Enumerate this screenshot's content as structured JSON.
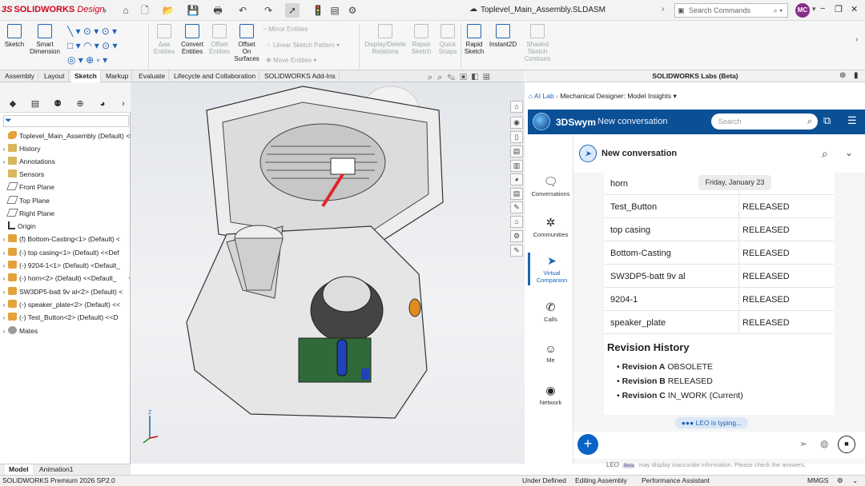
{
  "app": {
    "brand_prefix": "3S",
    "brand_name": "SOLIDWORKS",
    "brand_suffix": "Design",
    "document_title": "Toplevel_Main_Assembly.SLDASM",
    "search_placeholder": "Search Commands",
    "user_initials": "MC"
  },
  "ribbon": {
    "sketch": "Sketch",
    "smart_dimension_l1": "Smart",
    "smart_dimension_l2": "Dimension",
    "add_entities_l1": "Δaa",
    "add_entities_l2": "Entities",
    "convert_entities_l1": "Convert",
    "convert_entities_l2": "Entities",
    "offset_entities_l1": "Offset",
    "offset_entities_l2": "Entities",
    "offset_surfaces_l1": "Offset",
    "offset_surfaces_l2": "On",
    "offset_surfaces_l3": "Surfaces",
    "mirror_entities": "Mirror Entities",
    "linear_sketch_pattern": "Linear Sketch Pattern",
    "move_entities": "Move Entities",
    "display_delete_l1": "Display/Delete",
    "display_delete_l2": "Relations",
    "repair_sketch_l1": "Repair",
    "repair_sketch_l2": "Sketch",
    "quick_snaps_l1": "Quick",
    "quick_snaps_l2": "Snaps",
    "rapid_sketch_l1": "Rapid",
    "rapid_sketch_l2": "Sketch",
    "instant2d": "Instant2D",
    "shaded_l1": "Shaded",
    "shaded_l2": "Sketch",
    "shaded_l3": "Contours"
  },
  "tabs": [
    "Assembly",
    "Layout",
    "Sketch",
    "Markup",
    "Evaluate",
    "Lifecycle and Collaboration",
    "SOLIDWORKS Add-Ins"
  ],
  "tree": {
    "root": "Toplevel_Main_Assembly (Default) <D",
    "items": [
      "History",
      "Annotations",
      "Sensors",
      "Front Plane",
      "Top Plane",
      "Right Plane",
      "Origin",
      "(f) Bottom-Casting<1> (Default) <",
      "(-) top casing<1> (Default) <<Def",
      "(-) 9204-1<1> (Default) <Default_",
      "(-) horn<2> (Default) <<Default_",
      "SW3DP5-batt 9v al<2> (Default) <",
      "(-) speaker_plate<2> (Default) <<",
      "(-) Test_Button<2> (Default) <<D",
      "Mates"
    ]
  },
  "bottom_tabs": [
    "Model",
    "Animation1"
  ],
  "status": {
    "edition": "SOLIDWORKS Premium 2026 SP2.0",
    "defined": "Under Defined",
    "mode": "Editing Assembly",
    "assistant": "Performance Assistant",
    "units": "MMGS"
  },
  "labs": {
    "header": "SOLIDWORKS Labs (Beta)",
    "crumb_root": "AI Lab",
    "crumb_current": "Mechanical Designer: Model Insights"
  },
  "swym": {
    "name": "3DSwym",
    "conversation": "New conversation",
    "search_placeholder": "Search"
  },
  "nav": [
    "Conversations",
    "Communities",
    "Virtual Companion",
    "Calls",
    "Me",
    "Network"
  ],
  "chat": {
    "title": "New conversation",
    "date": "Friday, January 23",
    "rows": [
      {
        "part": "horn",
        "status": ""
      },
      {
        "part": "Test_Button",
        "status": "RELEASED"
      },
      {
        "part": "top casing",
        "status": "RELEASED"
      },
      {
        "part": "Bottom-Casting",
        "status": "RELEASED"
      },
      {
        "part": "SW3DP5-batt 9v al",
        "status": "RELEASED"
      },
      {
        "part": "9204-1",
        "status": "RELEASED"
      },
      {
        "part": "speaker_plate",
        "status": "RELEASED"
      }
    ],
    "revision_title": "Revision History",
    "revisions": [
      {
        "rev": "Revision A",
        "state": "OBSOLETE"
      },
      {
        "rev": "Revision B",
        "state": "RELEASED"
      },
      {
        "rev": "Revision C",
        "state": "IN_WORK (Current)"
      }
    ],
    "typing": "LEO is typing...",
    "disclaimer_name": "LEO",
    "disclaimer_badge": "Beta",
    "disclaimer_text": "may display inaccurate information. Please check the answers."
  }
}
